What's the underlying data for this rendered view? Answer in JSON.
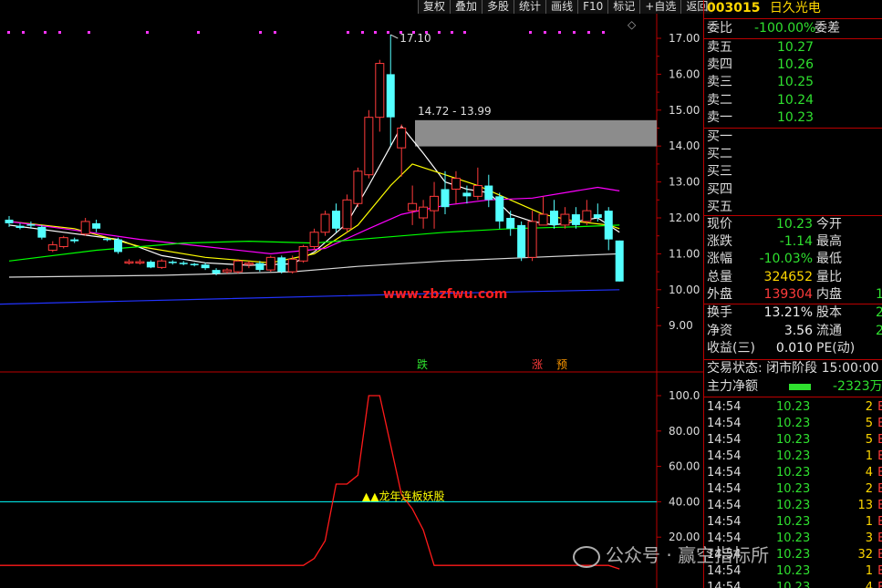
{
  "toolbar": [
    "复权",
    "叠加",
    "多股",
    "统计",
    "画线",
    "F10",
    "标记",
    "+自选",
    "返回"
  ],
  "stock": {
    "code": "003015",
    "name": "日久光电"
  },
  "colors": {
    "up": "#ff3b3b",
    "down": "#54ffff",
    "ma5": "#ffffff",
    "ma10": "#ffff00",
    "ma20": "#ff00ff",
    "ma60": "#00ff00",
    "ma120": "#d8d8d8",
    "ma250": "#2233ff",
    "indicator": "#ff1a1a",
    "level": "#00ffff"
  },
  "main_chart": {
    "y_ticks": [
      "17.00",
      "16.00",
      "15.00",
      "14.00",
      "13.00",
      "12.00",
      "11.00",
      "10.00",
      "9.00"
    ],
    "high_label": "17.10",
    "zone_label": "14.72 - 13.99",
    "watermark_url": "www.zbzfwu.com",
    "markers": {
      "die": "跌",
      "zhang": "涨",
      "yu": "预"
    },
    "zone": {
      "low": 13.99,
      "high": 14.72
    },
    "candles": [
      {
        "o": 11.95,
        "c": 11.85,
        "h": 12.05,
        "l": 11.75
      },
      {
        "o": 11.78,
        "c": 11.72,
        "h": 11.85,
        "l": 11.68
      },
      {
        "o": 11.82,
        "c": 11.8,
        "h": 11.9,
        "l": 11.7
      },
      {
        "o": 11.75,
        "c": 11.45,
        "h": 11.8,
        "l": 11.4
      },
      {
        "o": 11.1,
        "c": 11.25,
        "h": 11.35,
        "l": 11.05
      },
      {
        "o": 11.2,
        "c": 11.45,
        "h": 11.5,
        "l": 11.15
      },
      {
        "o": 11.4,
        "c": 11.35,
        "h": 11.45,
        "l": 11.3
      },
      {
        "o": 11.55,
        "c": 11.9,
        "h": 12.0,
        "l": 11.5
      },
      {
        "o": 11.85,
        "c": 11.7,
        "h": 11.95,
        "l": 11.6
      },
      {
        "o": 11.42,
        "c": 11.4,
        "h": 11.45,
        "l": 11.35
      },
      {
        "o": 11.4,
        "c": 11.05,
        "h": 11.45,
        "l": 11.0
      },
      {
        "o": 10.78,
        "c": 10.78,
        "h": 10.85,
        "l": 10.7
      },
      {
        "o": 10.78,
        "c": 10.78,
        "h": 10.85,
        "l": 10.7
      },
      {
        "o": 10.78,
        "c": 10.62,
        "h": 10.82,
        "l": 10.6
      },
      {
        "o": 10.62,
        "c": 10.8,
        "h": 10.85,
        "l": 10.58
      },
      {
        "o": 10.78,
        "c": 10.75,
        "h": 10.82,
        "l": 10.7
      },
      {
        "o": 10.75,
        "c": 10.72,
        "h": 10.8,
        "l": 10.68
      },
      {
        "o": 10.72,
        "c": 10.7,
        "h": 10.75,
        "l": 10.65
      },
      {
        "o": 10.7,
        "c": 10.6,
        "h": 10.75,
        "l": 10.55
      },
      {
        "o": 10.55,
        "c": 10.45,
        "h": 10.6,
        "l": 10.4
      },
      {
        "o": 10.5,
        "c": 10.55,
        "h": 10.6,
        "l": 10.45
      },
      {
        "o": 10.5,
        "c": 10.8,
        "h": 10.85,
        "l": 10.45
      },
      {
        "o": 10.72,
        "c": 10.74,
        "h": 10.8,
        "l": 10.6
      },
      {
        "o": 10.74,
        "c": 10.55,
        "h": 10.8,
        "l": 10.5
      },
      {
        "o": 10.55,
        "c": 10.9,
        "h": 10.95,
        "l": 10.5
      },
      {
        "o": 10.9,
        "c": 10.5,
        "h": 10.95,
        "l": 10.45
      },
      {
        "o": 10.5,
        "c": 10.85,
        "h": 10.95,
        "l": 10.45
      },
      {
        "o": 10.8,
        "c": 11.2,
        "h": 11.25,
        "l": 10.75
      },
      {
        "o": 11.2,
        "c": 11.6,
        "h": 11.7,
        "l": 11.1
      },
      {
        "o": 11.6,
        "c": 12.1,
        "h": 12.2,
        "l": 11.5
      },
      {
        "o": 12.2,
        "c": 11.7,
        "h": 12.4,
        "l": 11.6
      },
      {
        "o": 11.7,
        "c": 12.5,
        "h": 12.65,
        "l": 11.6
      },
      {
        "o": 12.4,
        "c": 13.3,
        "h": 13.4,
        "l": 12.3
      },
      {
        "o": 13.2,
        "c": 14.8,
        "h": 15.0,
        "l": 13.1
      },
      {
        "o": 14.8,
        "c": 16.3,
        "h": 16.4,
        "l": 14.4
      },
      {
        "o": 16.0,
        "c": 14.8,
        "h": 17.1,
        "l": 14.0
      },
      {
        "o": 13.95,
        "c": 14.5,
        "h": 14.6,
        "l": 13.15
      },
      {
        "o": 12.2,
        "c": 12.4,
        "h": 12.9,
        "l": 11.8
      },
      {
        "o": 12.0,
        "c": 12.3,
        "h": 12.5,
        "l": 11.7
      },
      {
        "o": 12.2,
        "c": 12.6,
        "h": 13.0,
        "l": 11.7
      },
      {
        "o": 12.8,
        "c": 12.3,
        "h": 13.3,
        "l": 12.1
      },
      {
        "o": 12.8,
        "c": 13.1,
        "h": 13.3,
        "l": 12.4
      },
      {
        "o": 12.7,
        "c": 12.6,
        "h": 12.9,
        "l": 12.4
      },
      {
        "o": 12.6,
        "c": 12.9,
        "h": 13.4,
        "l": 12.5
      },
      {
        "o": 12.9,
        "c": 12.5,
        "h": 13.2,
        "l": 12.3
      },
      {
        "o": 12.6,
        "c": 11.9,
        "h": 12.7,
        "l": 11.7
      },
      {
        "o": 12.0,
        "c": 11.7,
        "h": 12.2,
        "l": 11.5
      },
      {
        "o": 11.8,
        "c": 10.9,
        "h": 11.9,
        "l": 10.8
      },
      {
        "o": 10.9,
        "c": 11.9,
        "h": 12.2,
        "l": 10.8
      },
      {
        "o": 11.8,
        "c": 12.1,
        "h": 12.6,
        "l": 11.8
      },
      {
        "o": 12.2,
        "c": 11.8,
        "h": 12.5,
        "l": 11.7
      },
      {
        "o": 11.8,
        "c": 12.1,
        "h": 12.3,
        "l": 11.7
      },
      {
        "o": 12.1,
        "c": 11.8,
        "h": 12.3,
        "l": 11.7
      },
      {
        "o": 11.9,
        "c": 12.2,
        "h": 12.5,
        "l": 11.8
      },
      {
        "o": 12.1,
        "c": 12.0,
        "h": 12.4,
        "l": 11.9
      },
      {
        "o": 12.2,
        "c": 11.4,
        "h": 12.3,
        "l": 11.1
      },
      {
        "o": 11.37,
        "c": 10.23,
        "h": 11.37,
        "l": 10.23
      }
    ],
    "ma": {
      "ma5": [
        [
          0,
          11.8
        ],
        [
          5,
          11.6
        ],
        [
          10,
          11.4
        ],
        [
          14,
          10.95
        ],
        [
          18,
          10.75
        ],
        [
          22,
          10.68
        ],
        [
          26,
          10.72
        ],
        [
          28,
          11.05
        ],
        [
          31,
          11.85
        ],
        [
          33,
          12.9
        ],
        [
          35,
          14.0
        ],
        [
          36,
          14.55
        ],
        [
          38,
          13.8
        ],
        [
          40,
          13.0
        ],
        [
          42,
          12.8
        ],
        [
          44,
          12.7
        ],
        [
          46,
          12.1
        ],
        [
          48,
          11.9
        ],
        [
          50,
          11.8
        ],
        [
          52,
          11.9
        ],
        [
          54,
          12.0
        ],
        [
          56,
          11.6
        ]
      ],
      "ma10": [
        [
          0,
          11.9
        ],
        [
          6,
          11.7
        ],
        [
          12,
          11.2
        ],
        [
          18,
          10.9
        ],
        [
          24,
          10.75
        ],
        [
          28,
          11.0
        ],
        [
          32,
          11.8
        ],
        [
          35,
          12.9
        ],
        [
          37,
          13.5
        ],
        [
          40,
          13.2
        ],
        [
          43,
          12.9
        ],
        [
          46,
          12.5
        ],
        [
          49,
          12.1
        ],
        [
          52,
          11.9
        ],
        [
          55,
          11.8
        ],
        [
          56,
          11.7
        ]
      ],
      "ma20": [
        [
          0,
          11.9
        ],
        [
          5,
          11.7
        ],
        [
          12,
          11.4
        ],
        [
          18,
          11.2
        ],
        [
          24,
          11.0
        ],
        [
          29,
          11.15
        ],
        [
          33,
          11.7
        ],
        [
          36,
          12.1
        ],
        [
          40,
          12.35
        ],
        [
          44,
          12.5
        ],
        [
          48,
          12.55
        ],
        [
          52,
          12.75
        ],
        [
          54,
          12.85
        ],
        [
          56,
          12.75
        ]
      ],
      "ma60": [
        [
          0,
          10.8
        ],
        [
          8,
          11.1
        ],
        [
          16,
          11.3
        ],
        [
          22,
          11.35
        ],
        [
          28,
          11.3
        ],
        [
          34,
          11.45
        ],
        [
          40,
          11.6
        ],
        [
          46,
          11.7
        ],
        [
          52,
          11.75
        ],
        [
          56,
          11.8
        ]
      ],
      "ma120": [
        [
          0,
          10.35
        ],
        [
          14,
          10.4
        ],
        [
          26,
          10.5
        ],
        [
          32,
          10.65
        ],
        [
          40,
          10.8
        ],
        [
          48,
          10.9
        ],
        [
          56,
          11.0
        ]
      ],
      "ma250": [
        [
          0,
          9.6
        ],
        [
          20,
          9.75
        ],
        [
          40,
          9.9
        ],
        [
          56,
          10.0
        ]
      ]
    }
  },
  "indicator": {
    "y_ticks": [
      "100.0",
      "80.00",
      "60.00",
      "40.00",
      "20.00"
    ],
    "level": 40,
    "signal_label": "▲▲龙年连板妖股",
    "values": [
      4,
      4,
      4,
      4,
      4,
      4,
      4,
      4,
      4,
      4,
      4,
      4,
      4,
      4,
      4,
      4,
      4,
      4,
      4,
      4,
      4,
      4,
      4,
      4,
      4,
      4,
      4,
      4,
      8,
      18,
      50,
      50,
      55,
      100,
      100,
      72,
      44,
      36,
      24,
      4,
      4,
      4,
      4,
      4,
      4,
      4,
      4,
      4,
      4,
      4,
      4,
      4,
      4,
      4,
      4,
      4,
      2
    ]
  },
  "panel": {
    "weibi": {
      "label": "委比",
      "value": "-100.00%",
      "diff_label": "委差"
    },
    "asks": [
      {
        "label": "卖五",
        "price": "10.27"
      },
      {
        "label": "卖四",
        "price": "10.26"
      },
      {
        "label": "卖三",
        "price": "10.25"
      },
      {
        "label": "卖二",
        "price": "10.24"
      },
      {
        "label": "卖一",
        "price": "10.23"
      }
    ],
    "bids": [
      {
        "label": "买一"
      },
      {
        "label": "买二"
      },
      {
        "label": "买三"
      },
      {
        "label": "买四"
      },
      {
        "label": "买五"
      }
    ],
    "stats": [
      {
        "l1": "现价",
        "v": "10.23",
        "c": "green",
        "l2": "今开",
        "v2": ""
      },
      {
        "l1": "涨跌",
        "v": "-1.14",
        "c": "green",
        "l2": "最高",
        "v2": ""
      },
      {
        "l1": "涨幅",
        "v": "-10.03%",
        "c": "green",
        "l2": "最低",
        "v2": ""
      },
      {
        "l1": "总量",
        "v": "324652",
        "c": "yellow",
        "l2": "量比",
        "v2": ""
      },
      {
        "l1": "外盘",
        "v": "139304",
        "c": "red",
        "l2": "内盘",
        "v2": "1"
      }
    ],
    "stats2": [
      {
        "l1": "换手",
        "v": "13.21%",
        "l2": "股本",
        "v2": "2"
      },
      {
        "l1": "净资",
        "v": "3.56",
        "l2": "流通",
        "v2": "2"
      },
      {
        "l1": "收益(三)",
        "v": "0.010",
        "l2": "PE(动)",
        "v2": ""
      }
    ],
    "trade_state": "交易状态: 闭市阶段 15:00:00",
    "main_net": {
      "label": "主力净额",
      "value": "-2323万"
    },
    "ticks": [
      {
        "t": "14:54",
        "p": "10.23",
        "v": "2"
      },
      {
        "t": "14:54",
        "p": "10.23",
        "v": "5"
      },
      {
        "t": "14:54",
        "p": "10.23",
        "v": "5"
      },
      {
        "t": "14:54",
        "p": "10.23",
        "v": "1"
      },
      {
        "t": "14:54",
        "p": "10.23",
        "v": "4"
      },
      {
        "t": "14:54",
        "p": "10.23",
        "v": "2"
      },
      {
        "t": "14:54",
        "p": "10.23",
        "v": "13"
      },
      {
        "t": "14:54",
        "p": "10.23",
        "v": "1"
      },
      {
        "t": "14:54",
        "p": "10.23",
        "v": "3"
      },
      {
        "t": "14:54",
        "p": "10.23",
        "v": "32"
      },
      {
        "t": "14:54",
        "p": "10.23",
        "v": "1"
      },
      {
        "t": "14:54",
        "p": "10.23",
        "v": "4"
      }
    ]
  },
  "watermark": {
    "text": "公众号 · 赢空指标所"
  }
}
